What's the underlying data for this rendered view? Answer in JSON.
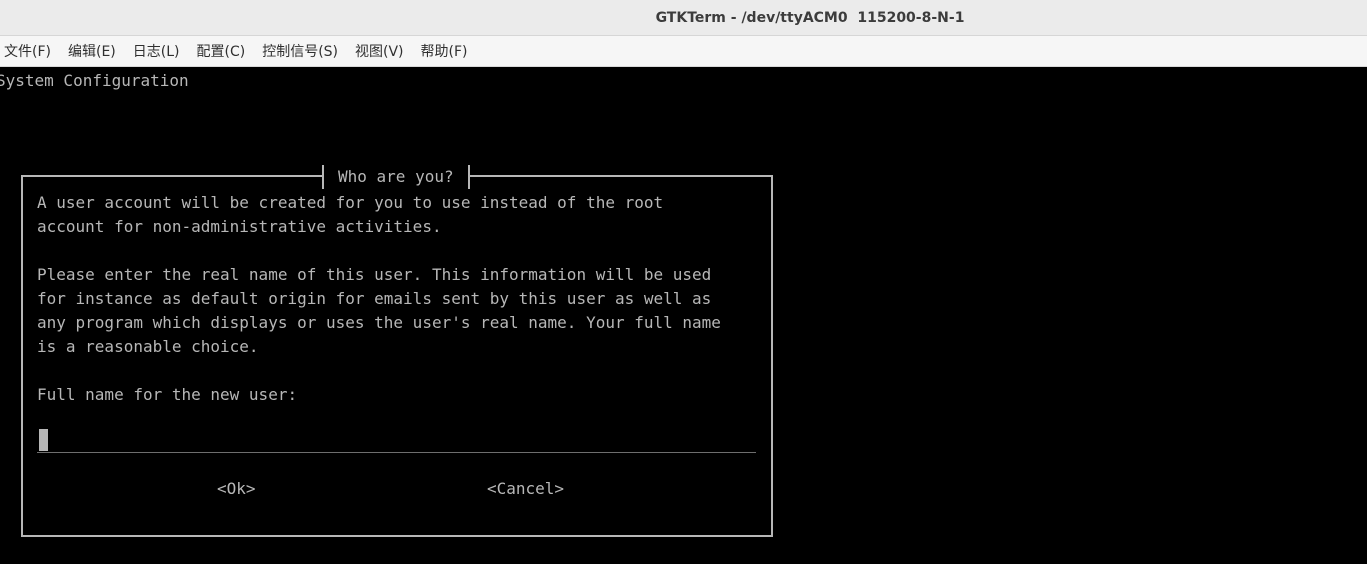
{
  "window": {
    "title": "GTKTerm - /dev/ttyACM0  115200-8-N-1"
  },
  "menubar": {
    "items": [
      {
        "label": "文件(F)"
      },
      {
        "label": "编辑(E)"
      },
      {
        "label": "日志(L)"
      },
      {
        "label": "配置(C)"
      },
      {
        "label": "控制信号(S)"
      },
      {
        "label": "视图(V)"
      },
      {
        "label": "帮助(F)"
      }
    ]
  },
  "terminal": {
    "header": "System Configuration",
    "dialog": {
      "title": "Who are you?",
      "paragraph1": [
        "A user account will be created for you to use instead of the root",
        "account for non-administrative activities."
      ],
      "paragraph2": [
        "Please enter the real name of this user. This information will be used",
        "for instance as default origin for emails sent by this user as well as",
        "any program which displays or uses the user's real name. Your full name",
        "is a reasonable choice."
      ],
      "prompt": "Full name for the new user:",
      "input_value": "",
      "ok_label": "<Ok>",
      "cancel_label": "<Cancel>"
    }
  },
  "colors": {
    "terminal_bg": "#000000",
    "terminal_fg": "#b7b7b7",
    "titlebar_bg": "#ebebeb",
    "menubar_bg": "#f6f6f6"
  }
}
